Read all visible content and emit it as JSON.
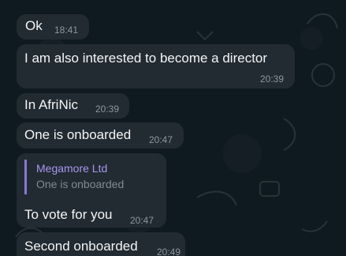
{
  "messages": [
    {
      "text": "Ok",
      "time": "18:41"
    },
    {
      "text": "I am also interested to become a director",
      "time": "20:39"
    },
    {
      "text": "In AfriNic",
      "time": "20:39"
    },
    {
      "text": "One is onboarded",
      "time": "20:47"
    },
    {
      "reply": {
        "author": "Megamore Ltd",
        "text": "One is onboarded"
      },
      "text": "To vote for you",
      "time": "20:47"
    },
    {
      "text": "Second onboarded",
      "time": "20:49"
    }
  ],
  "colors": {
    "background": "#0f1a20",
    "bubble": "#222b31",
    "reply_accent": "#8b78d2",
    "reply_name": "#a995f0",
    "time": "#8d969c"
  }
}
